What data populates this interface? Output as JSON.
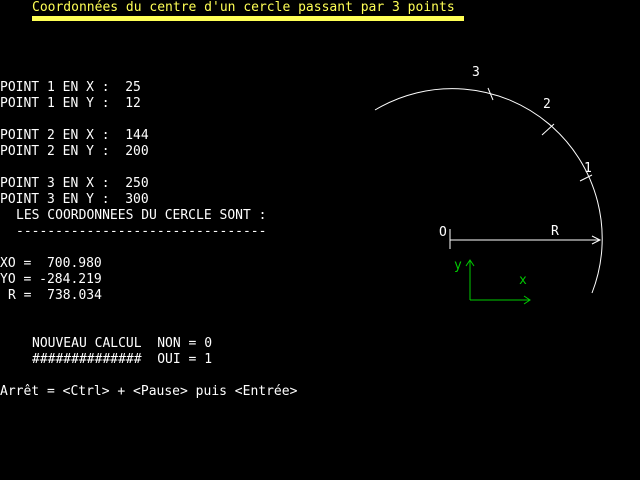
{
  "header": {
    "title": "Coordonnées du centre d'un cercle passant par 3 points",
    "title_color": "#ffff55"
  },
  "inputs": [
    {
      "label": "POINT 1 EN X :",
      "value": "25"
    },
    {
      "label": "POINT 1 EN Y :",
      "value": "12"
    },
    {
      "label": "POINT 2 EN X :",
      "value": "144"
    },
    {
      "label": "POINT 2 EN Y :",
      "value": "200"
    },
    {
      "label": "POINT 3 EN X :",
      "value": "250"
    },
    {
      "label": "POINT 3 EN Y :",
      "value": "300"
    }
  ],
  "results": {
    "heading": "LES COORDONNEES DU CERCLE SONT :",
    "separator": "--------------------------------",
    "xo_label": "XO =",
    "xo_value": "700.980",
    "yo_label": "YO =",
    "yo_value": "-284.219",
    "r_label": "R =",
    "r_value": "738.034"
  },
  "prompt": {
    "line1_label": "NOUVEAU CALCUL",
    "line1_option": "NON = 0",
    "line2_label": "##############",
    "line2_option": "OUI = 1"
  },
  "footer": {
    "hint": "Arrêt = <Ctrl> + <Pause> puis <Entrée>"
  },
  "diagram": {
    "point_labels": [
      "1",
      "2",
      "3"
    ],
    "center_label": "O",
    "radius_label": "R",
    "axis_x_label": "x",
    "axis_y_label": "y",
    "axis_color": "#00cc00",
    "line_color": "#ffffff"
  }
}
